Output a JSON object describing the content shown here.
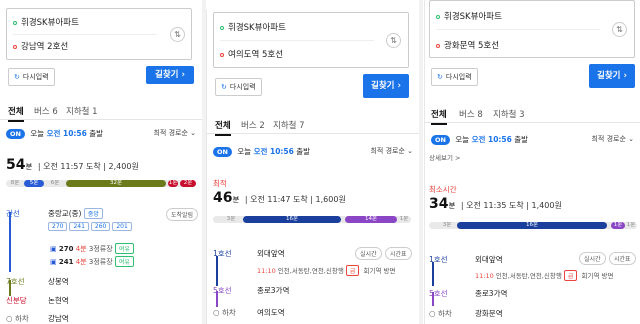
{
  "panels": [
    {
      "origin": "휘경SK뷰아파트",
      "destination": "강남역 2호선",
      "reset": "다시입력",
      "find": "길찾기",
      "tabs": [
        "전체",
        "버스 6",
        "지하철 1"
      ],
      "dep_on": "ON",
      "dep_prefix": "오늘",
      "dep_time": "오전 10:56",
      "dep_suffix": "출발",
      "sort": "최적 경로순",
      "duration_num": "54",
      "duration_unit": "분",
      "arrival": "오전 11:57 도착",
      "fare": "2,400원",
      "bar": {
        "start_label": "8분",
        "seg1": "5분",
        "seg1_gap": "6분",
        "seg2": "32분",
        "seg3": "1분",
        "seg3_after": "2분"
      },
      "steps": [
        {
          "type": "간선",
          "stop": "중랑교(중)",
          "stop_note": "중앙",
          "button": "도착알림"
        },
        {
          "type": "7호선",
          "stop": "상봉역"
        },
        {
          "type": "신분당",
          "stop": "논현역"
        },
        {
          "type": "하차",
          "stop": "강남역"
        }
      ],
      "bus_chips": [
        "270",
        "241",
        "260",
        "201"
      ],
      "bus_arrivals": [
        {
          "num": "270",
          "min": "4분",
          "stops": "3정류장",
          "tag": "여유"
        },
        {
          "num": "241",
          "min": "4분",
          "stops": "3정류장",
          "tag": "여유"
        }
      ]
    },
    {
      "origin": "휘경SK뷰아파트",
      "destination": "여의도역 5호선",
      "reset": "다시입력",
      "find": "길찾기",
      "tabs": [
        "전체",
        "버스 2",
        "지하철 7"
      ],
      "dep_on": "ON",
      "dep_prefix": "오늘",
      "dep_time": "오전 10:56",
      "dep_suffix": "출발",
      "sort": "최적 경로순",
      "category": "최적",
      "duration_num": "46",
      "duration_unit": "분",
      "arrival": "오전 11:47 도착",
      "fare": "1,600원",
      "bar": {
        "start_label": "3분",
        "seg1": "16분",
        "seg2": "14분",
        "end_label": "1분"
      },
      "steps": [
        {
          "type": "1호선",
          "stop": "외대앞역",
          "btn1": "실시간",
          "btn2": "시간표"
        },
        {
          "type": "5호선",
          "stop": "종로3가역"
        },
        {
          "type": "하차",
          "stop": "여의도역"
        }
      ],
      "train_note": {
        "time": "11:10",
        "text": "인천,서동탄,연천,신창행",
        "badge": "급",
        "gap": "회기역 방면"
      }
    },
    {
      "origin": "휘경SK뷰아파트",
      "destination": "광화문역 5호선",
      "reset": "다시입력",
      "find": "길찾기",
      "tabs": [
        "전체",
        "버스 8",
        "지하철 3"
      ],
      "dep_on": "ON",
      "dep_prefix": "오늘",
      "dep_time": "오전 10:56",
      "dep_suffix": "출발",
      "sort": "최적 경로순",
      "detail": "상세보기 >",
      "category": "최소시간",
      "duration_num": "34",
      "duration_unit": "분",
      "arrival": "오전 11:35 도착",
      "fare": "1,400원",
      "bar": {
        "start_label": "3분",
        "seg1": "16분",
        "seg2": "1분",
        "end_label": "1분"
      },
      "steps": [
        {
          "type": "1호선",
          "stop": "외대앞역",
          "btn1": "실시간",
          "btn2": "시간표"
        },
        {
          "type": "5호선",
          "stop": "종로3가역"
        },
        {
          "type": "하차",
          "stop": "광화문역"
        }
      ],
      "train_note": {
        "time": "11:10",
        "text": "인천,서동탄,연천,신창행",
        "badge": "급",
        "gap": "회기역 방면"
      }
    }
  ],
  "colors": {
    "accent": "#1a73e8",
    "line1": "#1a3f9c",
    "line2": "#2fa84f",
    "line5": "#8a46c4",
    "line7": "#6b7b1c",
    "sinbundang": "#c8102e",
    "bus_blue": "#2a5bd7"
  }
}
